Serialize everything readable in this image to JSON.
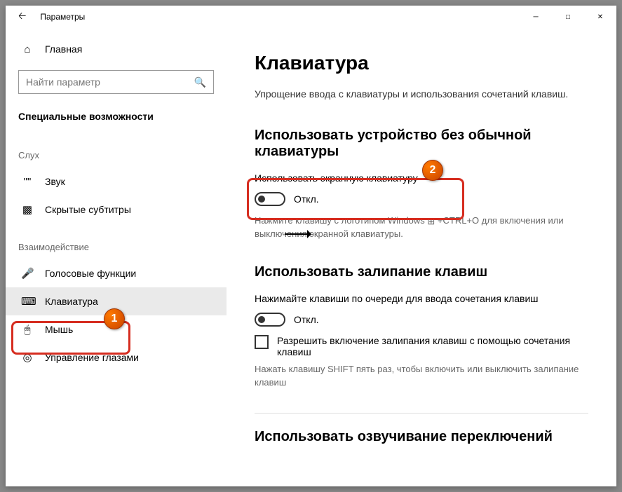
{
  "titlebar": {
    "title": "Параметры"
  },
  "sidebar": {
    "home": "Главная",
    "search_placeholder": "Найти параметр",
    "header": "Специальные возможности",
    "group_hearing": "Слух",
    "item_sound": "Звук",
    "item_cc": "Скрытые субтитры",
    "group_interaction": "Взаимодействие",
    "item_voice": "Голосовые функции",
    "item_keyboard": "Клавиатура",
    "item_mouse": "Мышь",
    "item_eye": "Управление глазами"
  },
  "content": {
    "title": "Клавиатура",
    "subtitle": "Упрощение ввода с клавиатуры и использования сочетаний клавиш.",
    "section1_title": "Использовать устройство без обычной клавиатуры",
    "osk_label": "Использовать экранную клавиатуру",
    "osk_state": "Откл.",
    "osk_hint_before": "Нажмите клавишу с логотипом Windows ",
    "osk_hint_after": " +CTRL+O для включения или выключения экранной клавиатуры.",
    "section2_title": "Использовать залипание клавиш",
    "sticky_label": "Нажимайте клавиши по очереди для ввода сочетания клавиш",
    "sticky_state": "Откл.",
    "sticky_checkbox": "Разрешить включение залипания клавиш с помощью сочетания клавиш",
    "sticky_hint": "Нажать клавишу SHIFT пять раз, чтобы включить или выключить залипание клавиш",
    "section3_title": "Использовать озвучивание переключений"
  },
  "markers": {
    "m1": "1",
    "m2": "2"
  }
}
